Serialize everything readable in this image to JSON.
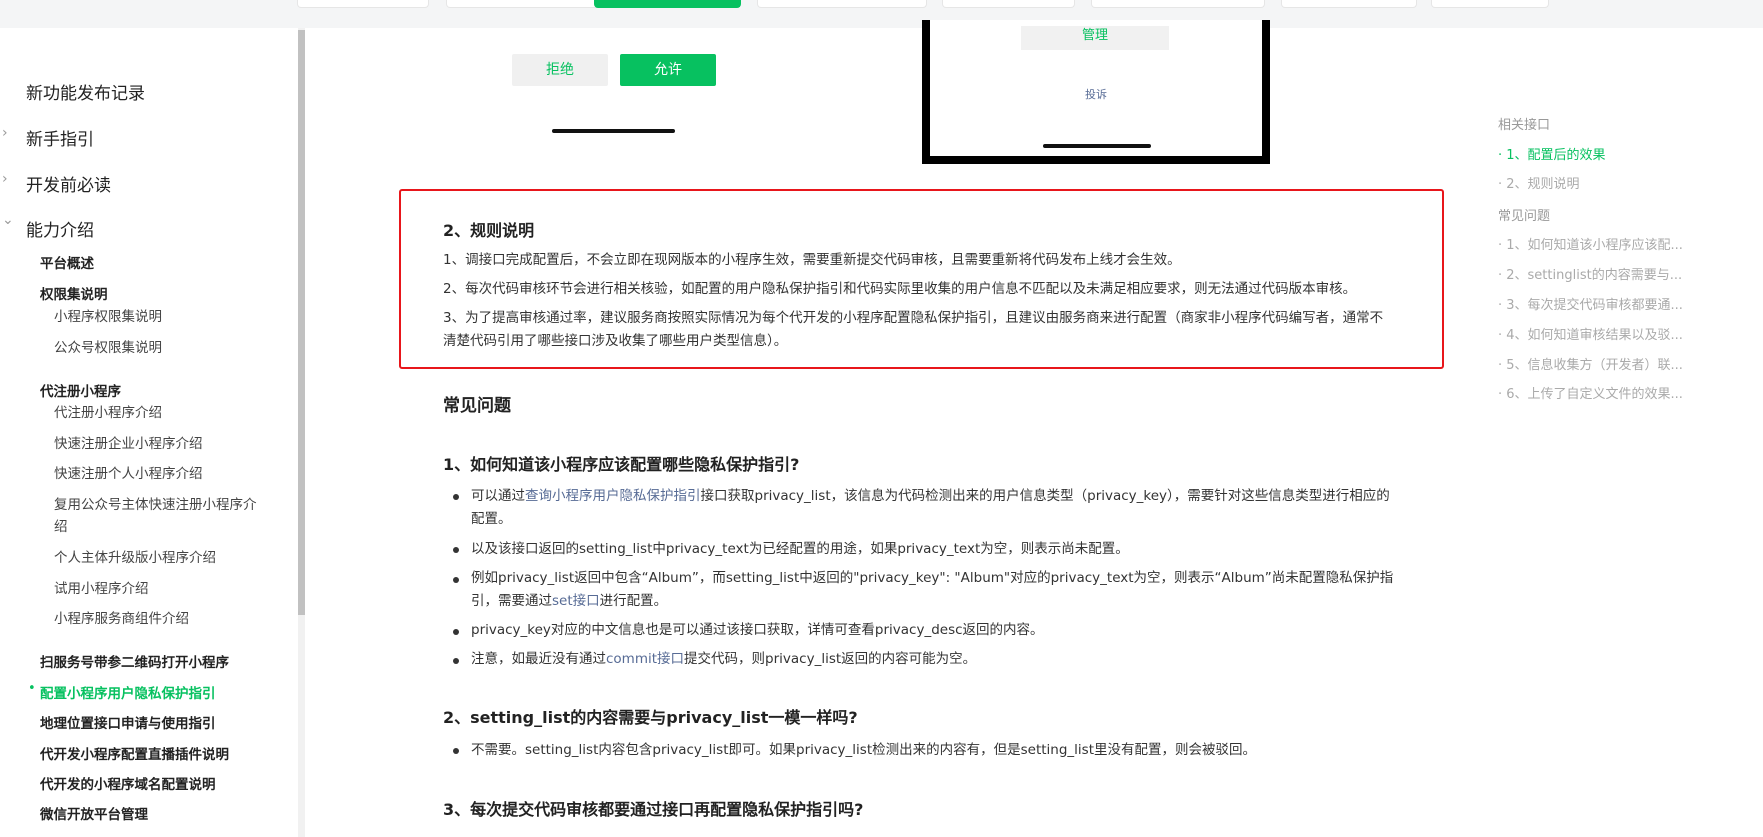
{
  "colors": {
    "accent": "#07c160",
    "link": "#576b95",
    "highlight_border": "#e8161b"
  },
  "sidebar": {
    "top_items": [
      {
        "label": "新功能发布记录",
        "caret": ""
      },
      {
        "label": "新手指引",
        "caret": "›"
      },
      {
        "label": "开发前必读",
        "caret": "›"
      },
      {
        "label": "能力介绍",
        "caret": "⌄"
      }
    ],
    "platform_overview": "平台概述",
    "permissions": {
      "label": "权限集说明",
      "items": [
        "小程序权限集说明",
        "公众号权限集说明"
      ]
    },
    "register": {
      "label": "代注册小程序",
      "items": [
        "代注册小程序介绍",
        "快速注册企业小程序介绍",
        "快速注册个人小程序介绍",
        "复用公众号主体快速注册小程序介",
        "绍",
        "个人主体升级版小程序介绍",
        "试用小程序介绍",
        "小程序服务商组件介绍"
      ]
    },
    "bottom_items": [
      "扫服务号带参二维码打开小程序",
      "配置小程序用户隐私保护指引",
      "地理位置接口申请与使用指引",
      "代开发小程序配置直播插件说明",
      "代开发的小程序域名配置说明",
      "微信开放平台管理"
    ],
    "active_bullet": "•"
  },
  "preview": {
    "reject_label": "拒绝",
    "allow_label": "允许",
    "manage_label": "管理",
    "complain_label": "投诉"
  },
  "rules": {
    "title": "2、规则说明",
    "p1": "1、调接口完成配置后，不会立即在现网版本的小程序生效，需要重新提交代码审核，且需要重新将代码发布上线才会生效。",
    "p2": "2、每次代码审核环节会进行相关核验，如配置的用户隐私保护指引和代码实际里收集的用户信息不匹配以及未满足相应要求，则无法通过代码版本审核。",
    "p3": "3、为了提高审核通过率，建议服务商按照实际情况为每个代开发的小程序配置隐私保护指引，且建议由服务商来进行配置（商家非小程序代码编写者，通常不清楚代码引用了哪些接口涉及收集了哪些用户类型信息）。"
  },
  "faq": {
    "heading": "常见问题",
    "q1": {
      "title": "1、如何知道该小程序应该配置哪些隐私保护指引?",
      "b1_pre": "可以通过",
      "b1_link": "查询小程序用户隐私保护指引",
      "b1_post": "接口获取privacy_list，该信息为代码检测出来的用户信息类型（privacy_key），需要针对这些信息类型进行相应的配置。",
      "b2": "以及该接口返回的setting_list中privacy_text为已经配置的用途，如果privacy_text为空，则表示尚未配置。",
      "b3_pre": "例如privacy_list返回中包含“Album”，而setting_list中返回的\"privacy_key\": \"Album\"对应的privacy_text为空，则表示“Album”尚未配置隐私保护指引，需要通过",
      "b3_link": "set接口",
      "b3_post": "进行配置。",
      "b4": "privacy_key对应的中文信息也是可以通过该接口获取，详情可查看privacy_desc返回的内容。",
      "b5_pre": "注意，如最近没有通过",
      "b5_link": "commit接口",
      "b5_post": "提交代码，则privacy_list返回的内容可能为空。"
    },
    "q2": {
      "title": "2、setting_list的内容需要与privacy_list一模一样吗?",
      "b1": "不需要。setting_list内容包含privacy_list即可。如果privacy_list检测出来的内容有，但是setting_list里没有配置，则会被驳回。"
    },
    "q3": {
      "title": "3、每次提交代码审核都要通过接口再配置隐私保护指引吗?"
    }
  },
  "toc": {
    "section1": "相关接口",
    "items1": [
      "· 1、配置后的效果",
      "· 2、规则说明"
    ],
    "section2": "常见问题",
    "items2": [
      "· 1、如何知道该小程序应该配...",
      "· 2、settinglist的内容需要与...",
      "· 3、每次提交代码审核都要通...",
      "· 4、如何知道审核结果以及驳...",
      "· 5、信息收集方（开发者）联...",
      "· 6、上传了自定义文件的效果..."
    ]
  }
}
